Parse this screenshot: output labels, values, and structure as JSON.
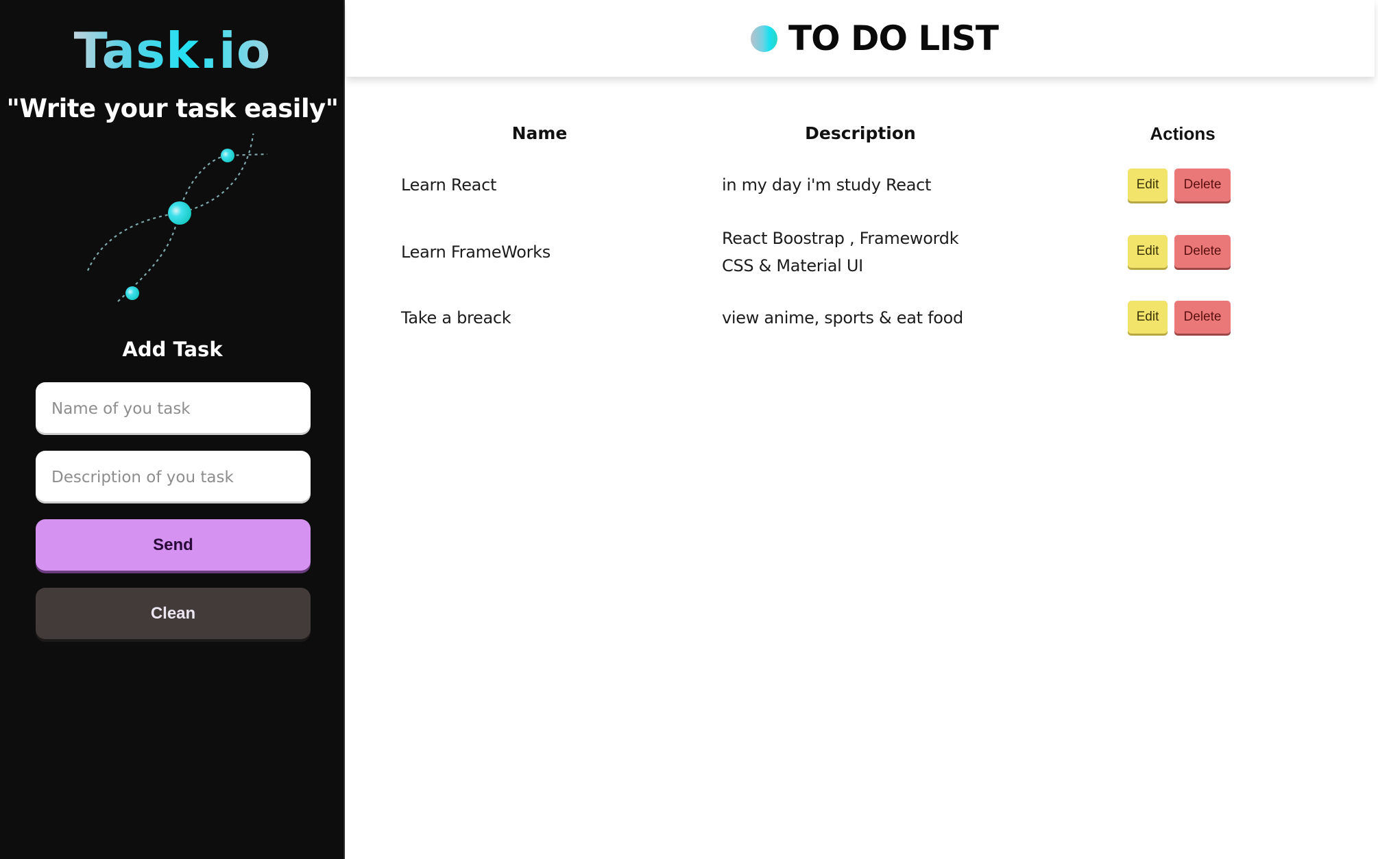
{
  "sidebar": {
    "brand": "Task.io",
    "tagline": "\"Write your task easily\"",
    "illustration_icon": "orbit-dots-illustration",
    "form": {
      "title": "Add Task",
      "name_placeholder": "Name of you task",
      "name_value": "",
      "description_placeholder": "Description of you task",
      "description_value": "",
      "send_label": "Send",
      "clean_label": "Clean"
    }
  },
  "header": {
    "icon": "gradient-dot-icon",
    "title": "TO DO LIST"
  },
  "table": {
    "columns": [
      "Name",
      "Description",
      "Actions"
    ],
    "rows": [
      {
        "name": "Learn React",
        "description_lines": [
          "in my day i'm study React"
        ],
        "edit_label": "Edit",
        "delete_label": "Delete"
      },
      {
        "name": "Learn FrameWorks",
        "description_lines": [
          "React Boostrap , Framewordk",
          "CSS & Material UI"
        ],
        "edit_label": "Edit",
        "delete_label": "Delete"
      },
      {
        "name": "Take a breack",
        "description_lines": [
          "view anime, sports & eat food"
        ],
        "edit_label": "Edit",
        "delete_label": "Delete"
      }
    ]
  },
  "colors": {
    "sidebar_bg": "#0d0d0d",
    "send_button": "#d592f0",
    "clean_button": "#433a3a",
    "edit_button": "#f2e46a",
    "delete_button": "#ea7878",
    "accent_cyan": "#22e0f2"
  }
}
